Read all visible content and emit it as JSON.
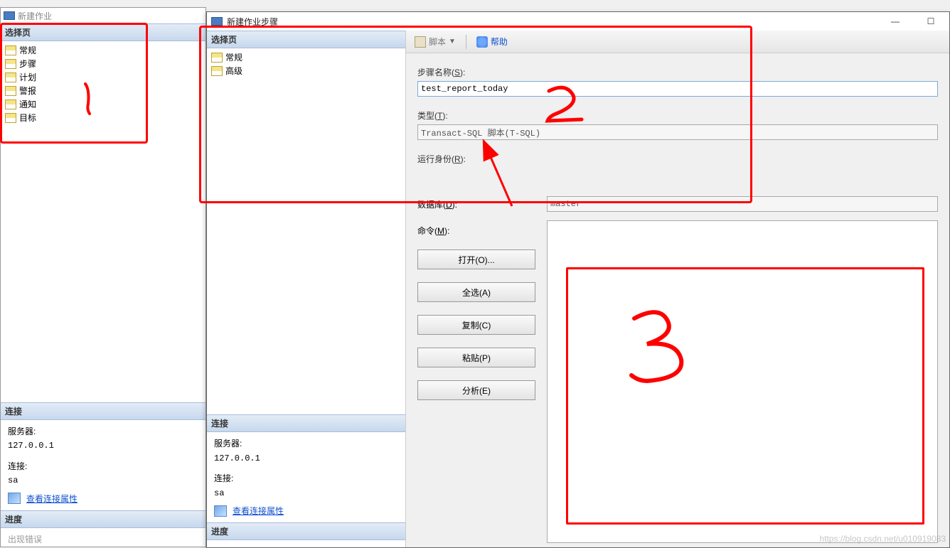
{
  "back": {
    "title": "新建作业",
    "select_header": "选择页",
    "nav": [
      "常规",
      "步骤",
      "计划",
      "警报",
      "通知",
      "目标"
    ],
    "conn_header": "连接",
    "server_label": "服务器:",
    "server_value": "127.0.0.1",
    "conn_label": "连接:",
    "conn_value": "sa",
    "view_conn_link": "查看连接属性",
    "progress_header": "进度",
    "progress_text": "出现错误"
  },
  "front": {
    "title": "新建作业步骤",
    "select_header": "选择页",
    "nav": [
      "常规",
      "高级"
    ],
    "toolbar": {
      "script": "脚本",
      "help": "帮助"
    },
    "form": {
      "step_name_label_pre": "步骤名称(",
      "step_name_hotkey": "S",
      "step_name_label_post": "):",
      "step_name_value": "test_report_today",
      "type_label_pre": "类型(",
      "type_hotkey": "T",
      "type_label_post": "):",
      "type_value": "Transact-SQL 脚本(T-SQL)",
      "runas_label_pre": "运行身份(",
      "runas_hotkey": "R",
      "runas_label_post": "):",
      "db_label_pre": "数据库(",
      "db_hotkey": "D",
      "db_label_post": "):",
      "db_value": "master",
      "cmd_label_pre": "命令(",
      "cmd_hotkey": "M",
      "cmd_label_post": "):",
      "buttons": {
        "open": "打开(O)...",
        "select_all": "全选(A)",
        "copy": "复制(C)",
        "paste": "粘贴(P)",
        "parse": "分析(E)"
      }
    },
    "conn_header": "连接",
    "server_label": "服务器:",
    "server_value": "127.0.0.1",
    "conn_label": "连接:",
    "conn_value": "sa",
    "view_conn_link": "查看连接属性",
    "progress_header": "进度"
  },
  "watermark": "https://blog.csdn.net/u010919083"
}
